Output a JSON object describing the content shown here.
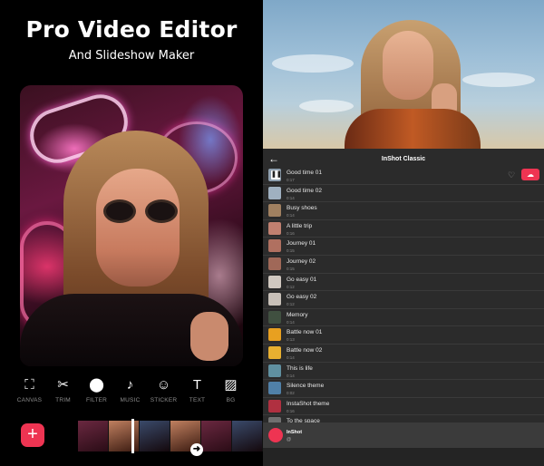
{
  "left": {
    "title": "Pro Video Editor",
    "subtitle": "And Slideshow Maker",
    "tools": [
      {
        "icon": "canvas-icon",
        "glyph": "⛶",
        "label": "CANVAS"
      },
      {
        "icon": "scissors-icon",
        "glyph": "✂",
        "label": "TRIM"
      },
      {
        "icon": "filter-icon",
        "glyph": "⬤",
        "label": "FILTER"
      },
      {
        "icon": "music-icon",
        "glyph": "♪",
        "label": "MUSIC"
      },
      {
        "icon": "sticker-icon",
        "glyph": "☺",
        "label": "STICKER"
      },
      {
        "icon": "text-icon",
        "glyph": "T",
        "label": "TEXT"
      },
      {
        "icon": "background-icon",
        "glyph": "▨",
        "label": "BG"
      }
    ],
    "add_glyph": "+",
    "arrow_glyph": "➜"
  },
  "right": {
    "back_glyph": "←",
    "playlist_title": "InShot Classic",
    "tracks": [
      {
        "name": "Good time 01",
        "duration": "0:17",
        "color": "#8fa0b0",
        "playing": true
      },
      {
        "name": "Good time 02",
        "duration": "0:14",
        "color": "#9fb0c0"
      },
      {
        "name": "Busy shoes",
        "duration": "0:14",
        "color": "#a08060"
      },
      {
        "name": "A little trip",
        "duration": "0:16",
        "color": "#c08070"
      },
      {
        "name": "Journey 01",
        "duration": "0:15",
        "color": "#b07060"
      },
      {
        "name": "Journey 02",
        "duration": "0:15",
        "color": "#a06858"
      },
      {
        "name": "Go easy 01",
        "duration": "0:12",
        "color": "#d0c8c0"
      },
      {
        "name": "Go easy 02",
        "duration": "0:12",
        "color": "#c8c0b8"
      },
      {
        "name": "Memory",
        "duration": "0:14",
        "color": "#405040"
      },
      {
        "name": "Battle now 01",
        "duration": "0:13",
        "color": "#e8a020"
      },
      {
        "name": "Battle now 02",
        "duration": "0:14",
        "color": "#e8b030"
      },
      {
        "name": "This is life",
        "duration": "0:14",
        "color": "#6090a0"
      },
      {
        "name": "Silence theme",
        "duration": "0:02",
        "color": "#5080a8"
      },
      {
        "name": "InstaShot theme",
        "duration": "0:16",
        "color": "#b03040"
      }
    ],
    "partial_track": "To the space",
    "heart_glyph": "♡",
    "download_glyph": "☁",
    "pause_glyph": "❚❚",
    "now_playing": {
      "name": "InShot",
      "sub": "@"
    }
  },
  "colors": {
    "accent": "#ee3452"
  }
}
